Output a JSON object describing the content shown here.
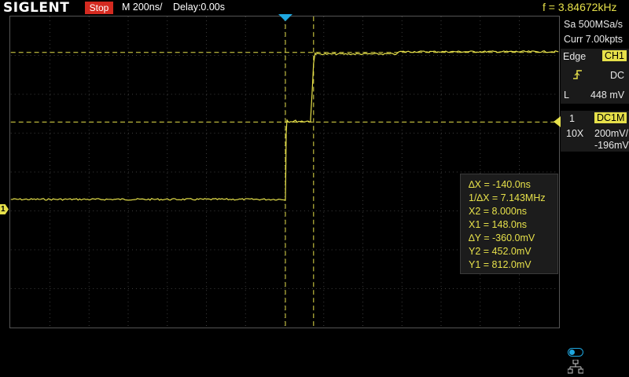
{
  "header": {
    "logo": "SIGLENT",
    "run_state": "Stop",
    "timebase": "M 200ns/",
    "delay": "Delay:0.00s",
    "frequency": "f = 3.84672kHz"
  },
  "acquisition": {
    "sample_rate": "Sa 500MSa/s",
    "memory": "Curr 7.00kpts"
  },
  "trigger": {
    "type": "Edge",
    "source": "CH1",
    "slope_icon": "rising-edge-icon",
    "coupling": "DC",
    "mode": "L",
    "level": "448 mV"
  },
  "channel": {
    "number": "1",
    "coupling": "DC1M",
    "probe": "10X",
    "scale": "200mV/",
    "offset": "-196mV"
  },
  "cursors": {
    "delta_x": "∆X = -140.0ns",
    "inv_delta_x": "1/∆X = 7.143MHz",
    "x2": "X2 = 8.000ns",
    "x1": "X1 = 148.0ns",
    "delta_y": "∆Y = -360.0mV",
    "y2": "Y2 = 452.0mV",
    "y1": "Y1 = 812.0mV"
  },
  "markers": {
    "ch1_ground_label": "1"
  },
  "colors": {
    "trace": "#e6e04a",
    "trigger_marker": "#1ea7e0",
    "stop_badge": "#d42a20",
    "grid": "#555555"
  }
}
